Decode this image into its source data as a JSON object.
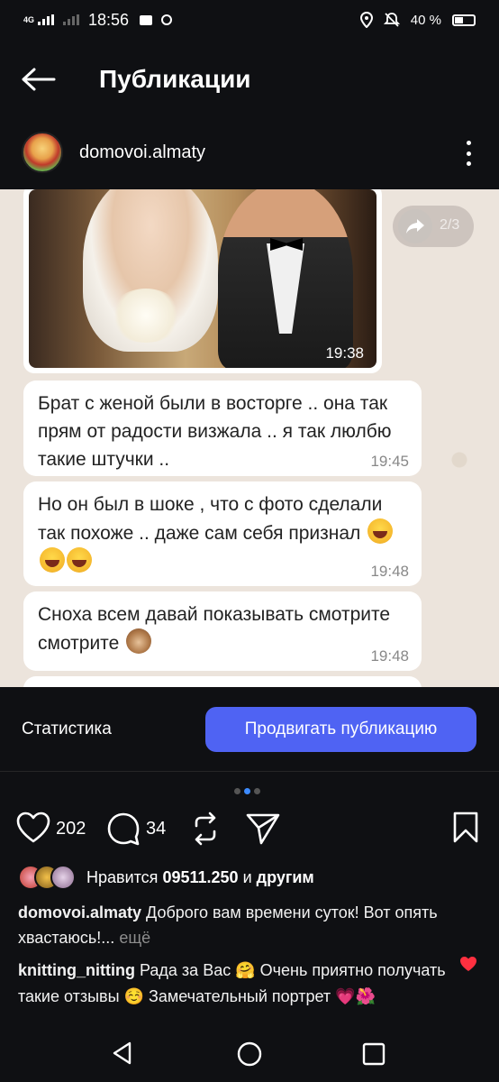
{
  "status_bar": {
    "network": "4G",
    "time": "18:56",
    "battery": "40 %"
  },
  "header": {
    "title": "Публикации"
  },
  "post": {
    "username": "domovoi.almaty",
    "counter": "2/3",
    "photo_time": "19:38",
    "messages": [
      {
        "text": "Брат с женой были в восторге .. она так прям от радости визжала .. я так люлбю такие штучки ..",
        "time": "19:45"
      },
      {
        "text": "Но он был в шоке , что с фото сделали так похоже .. даже сам себя признал",
        "time": "19:48"
      },
      {
        "text": "Сноха всем давай показывать смотрите смотрите",
        "time": "19:48"
      }
    ]
  },
  "actions": {
    "statistics_label": "Статистика",
    "promote_label": "Продвигать публикацию",
    "like_count": "202",
    "comment_count": "34"
  },
  "likes": {
    "prefix": "Нравится",
    "user": "09511.250",
    "and": "и",
    "others": "другим"
  },
  "caption": {
    "user": "domovoi.almaty",
    "text": "Доброго вам времени суток! Вот опять хвастаюсь!...",
    "more": "ещё"
  },
  "comment": {
    "user": "knitting_nitting",
    "text": "Рада за Вас 🤗 Очень приятно получать такие отзывы ☺️ Замечательный портрет 💗🌺"
  },
  "colors": {
    "accent": "#4f63f3",
    "background": "#0f1013",
    "chat_bg": "#ece4dc",
    "heart_red": "#ff3040"
  }
}
